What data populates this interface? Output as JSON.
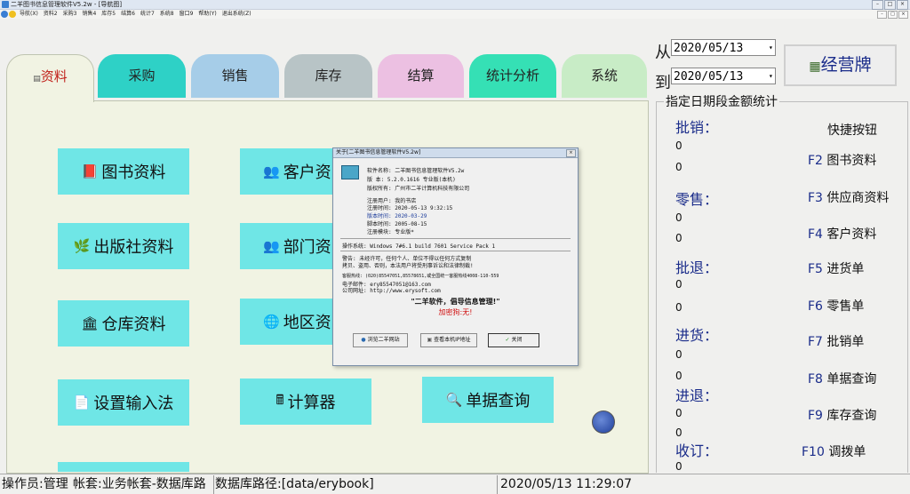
{
  "window": {
    "title": "二羊图书信息管理软件V5.2w - [导航图]",
    "buttons": [
      "–",
      "□",
      "×"
    ]
  },
  "menu": {
    "items": [
      "导航(X)",
      "资料2",
      "采购3",
      "销售4",
      "库存5",
      "结算6",
      "统计7",
      "系统8",
      "窗口9",
      "帮助(Y)",
      "退出系统(Z)"
    ]
  },
  "tabs": [
    {
      "label": "资料",
      "color": "#f1f3e3"
    },
    {
      "label": "采购",
      "color": "#2ed1c6"
    },
    {
      "label": "销售",
      "color": "#a6cde8"
    },
    {
      "label": "库存",
      "color": "#b8c4c6"
    },
    {
      "label": "结算",
      "color": "#ecc0e2"
    },
    {
      "label": "统计分析",
      "color": "#35e0b5"
    },
    {
      "label": "系统",
      "color": "#c8ecc6"
    }
  ],
  "function_buttons": [
    {
      "label": "图书资料",
      "icon": "book-icon",
      "glyph": "📕"
    },
    {
      "label": "出版社资料",
      "icon": "leaf-icon",
      "glyph": "🌿"
    },
    {
      "label": "仓库资料",
      "icon": "building-icon",
      "glyph": "🏛"
    },
    {
      "label": "设置输入法",
      "icon": "document-icon",
      "glyph": "📄"
    },
    {
      "label": "客户资",
      "icon": "people-icon",
      "glyph": "👥"
    },
    {
      "label": "部门资",
      "icon": "people-icon",
      "glyph": "👥"
    },
    {
      "label": "地区资",
      "icon": "globe-icon",
      "glyph": "🌐"
    },
    {
      "label": "计算器",
      "icon": "calculator-icon",
      "glyph": "🖩"
    },
    {
      "label": "单据查询",
      "icon": "search-icon",
      "glyph": "🔍"
    }
  ],
  "date_range": {
    "from_label": "从",
    "to_label": "到",
    "from": "2020/05/13",
    "to": "2020/05/13"
  },
  "business_button": {
    "label": "经营牌",
    "icon": "board-icon"
  },
  "stats": {
    "title": "指定日期段金额统计",
    "categories": [
      {
        "label": "批销：",
        "values": [
          "0",
          "0"
        ]
      },
      {
        "label": "零售：",
        "values": [
          "0",
          "0"
        ]
      },
      {
        "label": "批退：",
        "values": [
          "0",
          "0"
        ]
      },
      {
        "label": "进货：",
        "values": [
          "0",
          "0"
        ]
      },
      {
        "label": "进退：",
        "values": [
          "0",
          "0"
        ]
      },
      {
        "label": "收订：",
        "values": [
          "0"
        ]
      }
    ]
  },
  "shortcuts": {
    "title": "快捷按钮",
    "items": [
      {
        "key": "F2",
        "label": "图书资料"
      },
      {
        "key": "F3",
        "label": "供应商资料"
      },
      {
        "key": "F4",
        "label": "客户资料"
      },
      {
        "key": "F5",
        "label": "进货单"
      },
      {
        "key": "F6",
        "label": "零售单"
      },
      {
        "key": "F7",
        "label": "批销单"
      },
      {
        "key": "F8",
        "label": "单据查询"
      },
      {
        "key": "F9",
        "label": "库存查询"
      },
      {
        "key": "F10",
        "label": "调拨单"
      }
    ]
  },
  "statusbar": {
    "operator": "操作员:管理",
    "account": "帐套:业务帐套-数据库路",
    "db_path": "数据库路径:[data/erybook]",
    "datetime": "2020/05/13 11:29:07"
  },
  "about_dialog": {
    "title": "关于[二羊图书信息管理软件V5.2w]",
    "lines": [
      "软件名称: 二羊图书信息管理软件V5.2w",
      "版    本: 5.2.0.1616  专业版(本机)",
      "版权所有: 广州市二羊计算机科技有限公司",
      "注册用户: 我的书店",
      "注册时间: 2020-05-13 9:32:15",
      "版本时间: 2020-03-29",
      "脚本时间: 2005-08-15",
      "注册模块: 专业版*",
      "操作系统: Windows 7#6.1 build 7601 Service Pack 1",
      "警告: 未经许可，任何个人、单位不得以任何方式复制",
      "拷贝、盗用、否则，本法用户将受刑事诉讼和法律制裁!",
      "客服热线: (020)85547051,85578651,或全国统一客服热线4008-110-559",
      "电子邮件: ery85547051@163.com",
      "公司网址: http://www.erysoft.com"
    ],
    "slogan": "\"二羊软件，倡导信息管理!\"",
    "dongle": "加密狗:无!",
    "buttons": [
      "浏览二羊网站",
      "查看本机IP地址",
      "关闭"
    ]
  }
}
